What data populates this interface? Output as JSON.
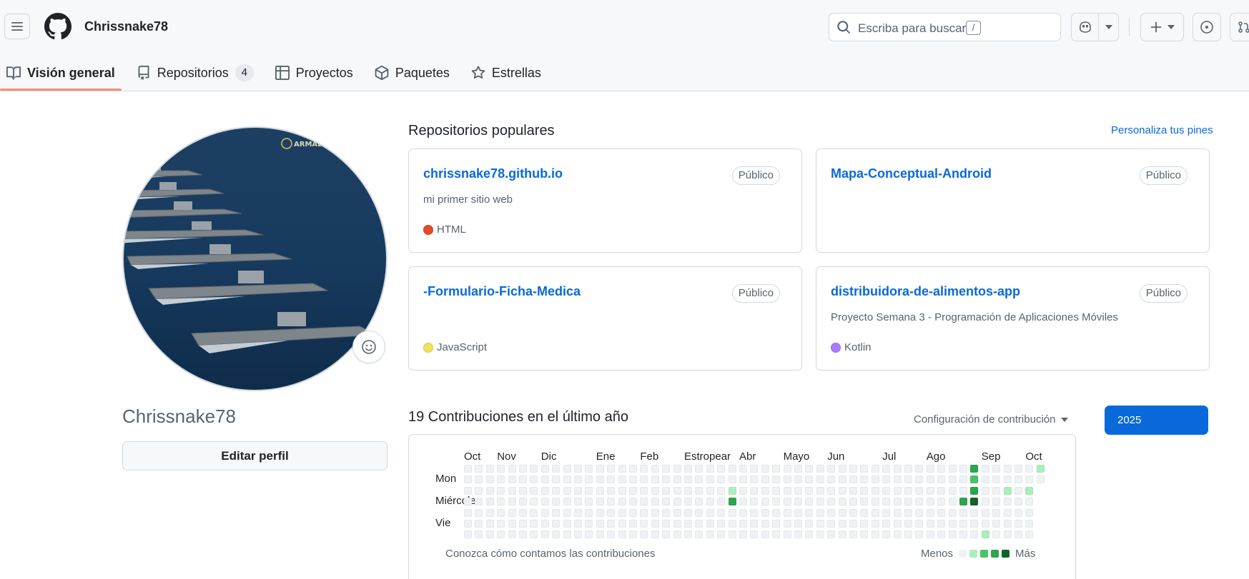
{
  "header": {
    "username": "Chrissnake78",
    "search_placeholder": "Escriba para buscar",
    "search_shortcut": "/"
  },
  "tabs": [
    {
      "label": "Visión general",
      "icon": "book-icon",
      "active": true
    },
    {
      "label": "Repositorios",
      "icon": "repo-icon",
      "count": "4"
    },
    {
      "label": "Proyectos",
      "icon": "table-icon"
    },
    {
      "label": "Paquetes",
      "icon": "package-icon"
    },
    {
      "label": "Estrellas",
      "icon": "star-icon"
    }
  ],
  "profile": {
    "name": "Chrissnake78",
    "edit_label": "Editar perfil",
    "avatar_watermark": "ARMADA"
  },
  "popular": {
    "title": "Repositorios populares",
    "customize_label": "Personaliza tus pines",
    "repos": [
      {
        "name": "chrissnake78.github.io",
        "badge": "Público",
        "description": "mi primer sitio web",
        "language": "HTML",
        "lang_color": "#e34c26"
      },
      {
        "name": "Mapa-Conceptual-Android",
        "badge": "Público",
        "description": "",
        "language": "",
        "lang_color": ""
      },
      {
        "name": "-Formulario-Ficha-Medica",
        "badge": "Público",
        "description": "",
        "language": "JavaScript",
        "lang_color": "#f1e05a"
      },
      {
        "name": "distribuidora-de-alimentos-app",
        "badge": "Público",
        "description": "Proyecto Semana 3 - Programación de Aplicaciones Móviles",
        "language": "Kotlin",
        "lang_color": "#a97bff"
      }
    ]
  },
  "contributions": {
    "title": "19 Contribuciones en el último año",
    "settings_label": "Configuración de contribución",
    "year": "2025",
    "months": [
      "Oct",
      "Nov",
      "Dic",
      "Ene",
      "Feb",
      "Estropear",
      "Abr",
      "Mayo",
      "Jun",
      "Jul",
      "Ago",
      "Sep",
      "Oct"
    ],
    "day_labels": [
      "Mon",
      "Miércoles",
      "Vie"
    ],
    "learn_label": "Conozca cómo contamos las contribuciones",
    "less_label": "Menos",
    "more_label": "Más",
    "level_colors": [
      "#eff2f5",
      "#aceebb",
      "#4ac26b",
      "#2da44e",
      "#116329"
    ],
    "active_cells": [
      {
        "week": 24,
        "day": 2,
        "level": 1
      },
      {
        "week": 24,
        "day": 3,
        "level": 3
      },
      {
        "week": 45,
        "day": 3,
        "level": 3
      },
      {
        "week": 46,
        "day": 0,
        "level": 3
      },
      {
        "week": 46,
        "day": 1,
        "level": 2
      },
      {
        "week": 46,
        "day": 2,
        "level": 3
      },
      {
        "week": 46,
        "day": 3,
        "level": 4
      },
      {
        "week": 47,
        "day": 6,
        "level": 1
      },
      {
        "week": 49,
        "day": 2,
        "level": 1
      },
      {
        "week": 51,
        "day": 2,
        "level": 1
      },
      {
        "week": 52,
        "day": 0,
        "level": 1
      }
    ]
  }
}
